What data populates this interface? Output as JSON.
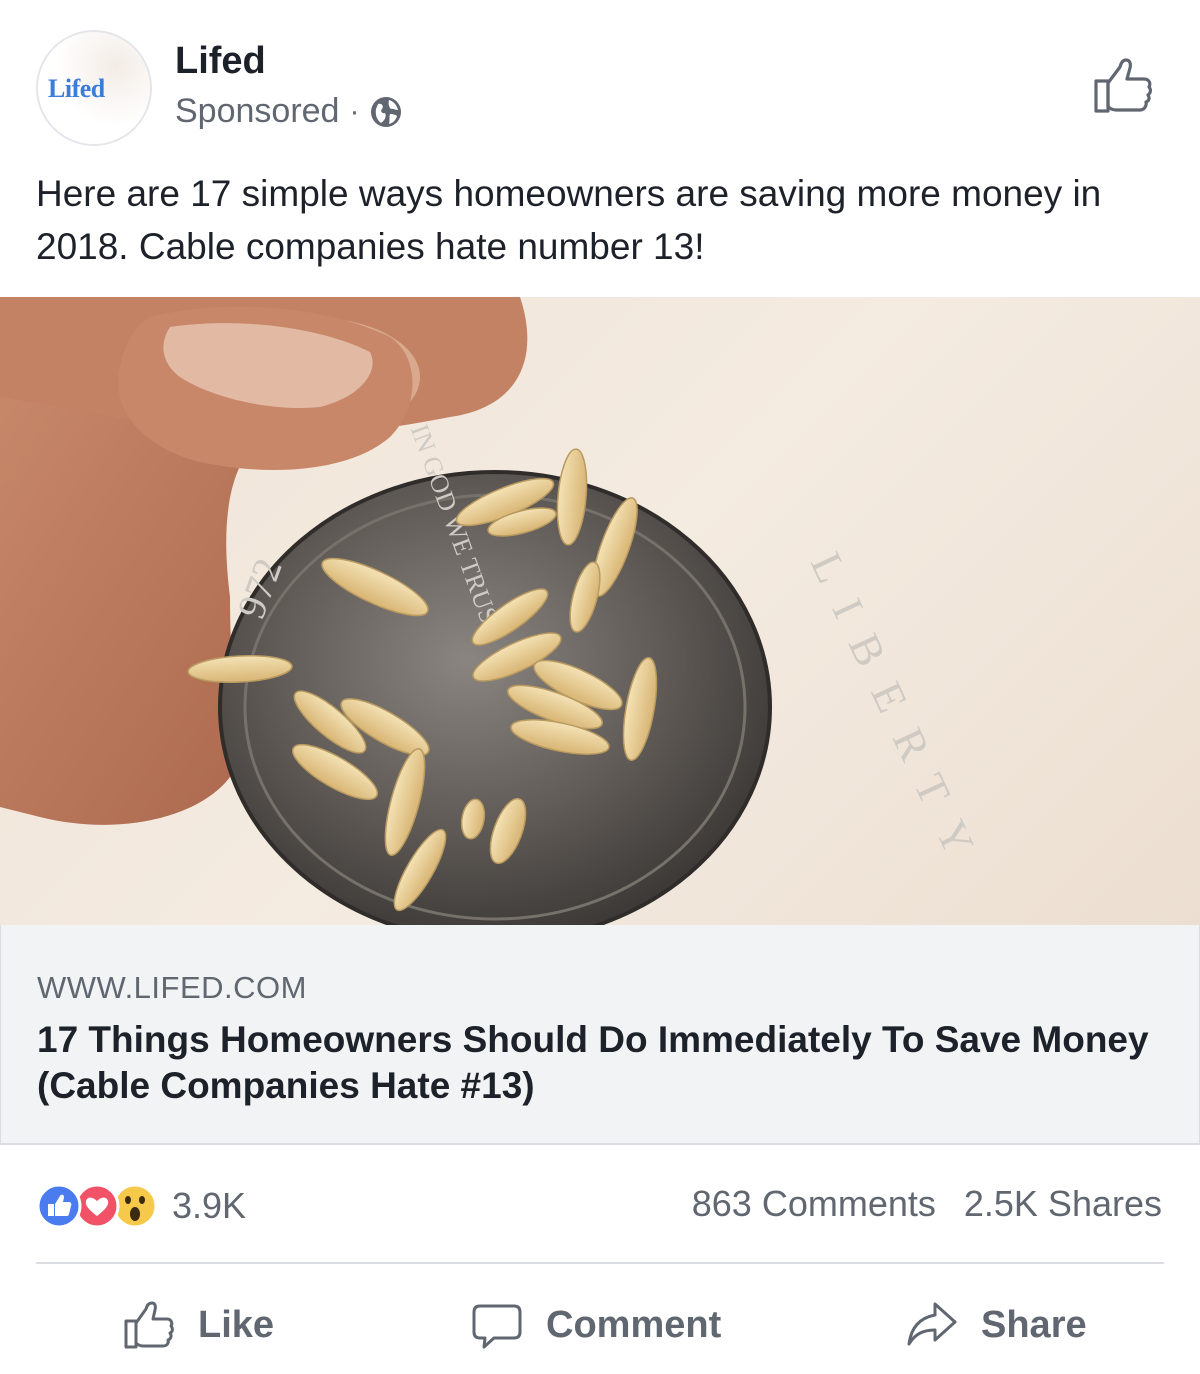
{
  "post": {
    "page_name": "Lifed",
    "avatar_text": "Lifed",
    "sponsored_label": "Sponsored",
    "meta_separator": "·",
    "privacy_icon": "globe-icon",
    "caption": "Here are 17 simple ways homeowners are saving more money in 2018. Cable companies hate number 13!"
  },
  "photo": {
    "coin_text_motto": "IN GOD WE TRUST",
    "coin_text_liberty": "LIBERTY",
    "coin_text_year": "972"
  },
  "link": {
    "domain": "WWW.LIFED.COM",
    "title": "17 Things Homeowners Should Do Immediately To Save Money (Cable Companies Hate #13)"
  },
  "stats": {
    "reaction_icons": [
      "like-reaction-icon",
      "love-reaction-icon",
      "wow-reaction-icon"
    ],
    "reaction_count": "3.9K",
    "comments": "863 Comments",
    "shares": "2.5K Shares"
  },
  "actions": {
    "like": "Like",
    "comment": "Comment",
    "share": "Share"
  },
  "colors": {
    "facebook_blue": "#4267b2",
    "love_red": "#f33e58",
    "wow_yellow": "#f7b928",
    "text_secondary": "#606770"
  }
}
